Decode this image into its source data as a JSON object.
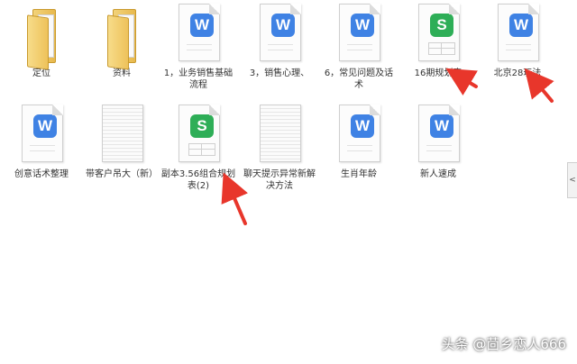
{
  "files": [
    {
      "label": "定位",
      "type": "folder"
    },
    {
      "label": "资料",
      "type": "folder"
    },
    {
      "label": "1，业务销售基础流程",
      "type": "word"
    },
    {
      "label": "3，销售心理、",
      "type": "word"
    },
    {
      "label": "6，常见问题及话术",
      "type": "word"
    },
    {
      "label": "16期规划表",
      "type": "sheet"
    },
    {
      "label": "北京28玩法",
      "type": "word"
    },
    {
      "label": "创意话术整理",
      "type": "word"
    },
    {
      "label": "带客户吊大（新）",
      "type": "text"
    },
    {
      "label": "副本3.56组合规划表(2)",
      "type": "sheet"
    },
    {
      "label": "聊天提示异常新解决方法",
      "type": "text"
    },
    {
      "label": "生肖年龄",
      "type": "word"
    },
    {
      "label": "新人速成",
      "type": "word"
    }
  ],
  "badges": {
    "word": "W",
    "sheet": "S"
  },
  "scroll_tab": "<",
  "watermark": "头条 @茴乡恋人666",
  "colors": {
    "word": "#3f82e4",
    "sheet": "#2eae57",
    "arrow": "#e8362b"
  }
}
